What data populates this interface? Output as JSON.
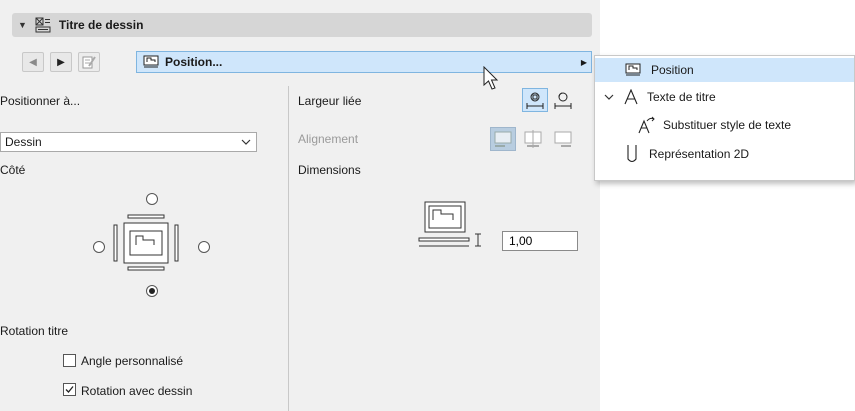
{
  "header": {
    "title": "Titre de dessin",
    "collapse_icon": "triangle-down-icon",
    "section_icon": "drawing-title-icon"
  },
  "navbar": {
    "prev_icon": "triangle-left-icon",
    "next_icon": "triangle-right-icon",
    "edit_icon": "edit-icon",
    "selected_label": "Position...",
    "selected_icon": "position-icon",
    "submenu_icon": "triangle-right-icon"
  },
  "left": {
    "position_label": "Positionner à...",
    "position_dropdown": {
      "value": "Dessin",
      "options": [
        "Dessin"
      ]
    },
    "side_label": "Côté",
    "side_selected": "bottom",
    "rotation_label": "Rotation titre",
    "custom_angle": {
      "label": "Angle personnalisé",
      "checked": false
    },
    "rotate_with_drawing": {
      "label": "Rotation avec dessin",
      "checked": true
    }
  },
  "right": {
    "linked_width_label": "Largeur liée",
    "alignment_label": "Alignement",
    "dimensions_label": "Dimensions",
    "dimension_value": "1,00"
  },
  "popup_menu": {
    "items": [
      {
        "label": "Position",
        "icon": "position-icon",
        "highlighted": true
      },
      {
        "label": "Texte de titre",
        "icon": "text-a-icon",
        "expanded": true
      },
      {
        "label": "Substituer style de texte",
        "icon": "text-style-override-icon"
      },
      {
        "label": "Représentation 2D",
        "icon": "2d-representation-icon"
      }
    ]
  },
  "colors": {
    "highlight": "#cfe6fb",
    "panel": "#f0f0f0",
    "header": "#d6d6d6"
  }
}
